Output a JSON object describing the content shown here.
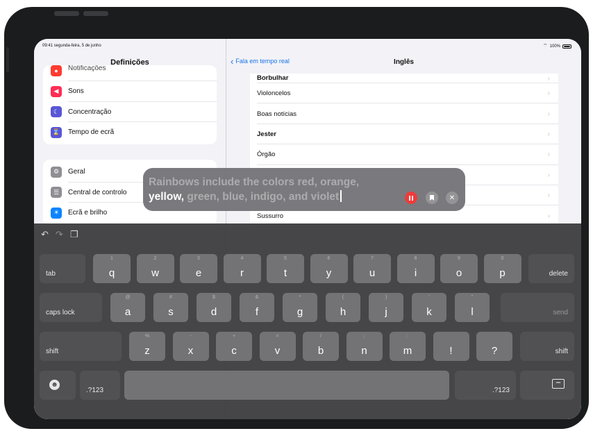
{
  "status": {
    "time": "09:41 segunda-feira, 5 de junho",
    "battery": "100%"
  },
  "sidebar": {
    "title": "Definições",
    "partial_item": "Notificações",
    "group1": [
      {
        "label": "Sons",
        "icon": "speaker-icon",
        "color": "#ff2d55"
      },
      {
        "label": "Concentração",
        "icon": "moon-icon",
        "color": "#5856d6"
      },
      {
        "label": "Tempo de ecrã",
        "icon": "hourglass-icon",
        "color": "#5856d6"
      }
    ],
    "group2": [
      {
        "label": "Geral",
        "icon": "gear-icon",
        "color": "#8e8e93"
      },
      {
        "label": "Central de controlo",
        "icon": "switches-icon",
        "color": "#8e8e93"
      },
      {
        "label": "Ecrã e brilho",
        "icon": "sun-icon",
        "color": "#0a84ff"
      }
    ]
  },
  "detail": {
    "back_label": "Fala em tempo real",
    "title": "Inglês",
    "items": [
      "Borbulhar",
      "Violoncelos",
      "Boas notícias",
      "Jester",
      "Órgão",
      "",
      "",
      "Sussurro"
    ]
  },
  "live_speech": {
    "line1": "Rainbows include the colors red, orange,",
    "highlighted": "yellow,",
    "rest": " green, blue, indigo, and violet"
  },
  "keyboard": {
    "row1": {
      "tab": "tab",
      "keys": [
        [
          "1",
          "q"
        ],
        [
          "2",
          "w"
        ],
        [
          "3",
          "e"
        ],
        [
          "4",
          "r"
        ],
        [
          "5",
          "t"
        ],
        [
          "6",
          "y"
        ],
        [
          "7",
          "u"
        ],
        [
          "8",
          "i"
        ],
        [
          "9",
          "o"
        ],
        [
          "0",
          "p"
        ]
      ],
      "delete": "delete"
    },
    "row2": {
      "caps": "caps lock",
      "keys": [
        [
          "@",
          "a"
        ],
        [
          "#",
          "s"
        ],
        [
          "$",
          "d"
        ],
        [
          "&",
          "f"
        ],
        [
          "*",
          "g"
        ],
        [
          "(",
          "h"
        ],
        [
          ")",
          "j"
        ],
        [
          "'",
          "k"
        ],
        [
          "\"",
          "l"
        ]
      ],
      "send": "send"
    },
    "row3": {
      "shift": "shift",
      "keys": [
        [
          "%",
          "z"
        ],
        [
          "-",
          "x"
        ],
        [
          "+",
          "c"
        ],
        [
          "=",
          "v"
        ],
        [
          "/",
          "b"
        ],
        [
          ";",
          "n"
        ],
        [
          ":",
          "m"
        ],
        [
          "",
          "!"
        ],
        [
          "",
          "?"
        ]
      ],
      "shift_right": "shift"
    },
    "row4": {
      "num_left": ".?123",
      "num_right": ".?123"
    }
  }
}
